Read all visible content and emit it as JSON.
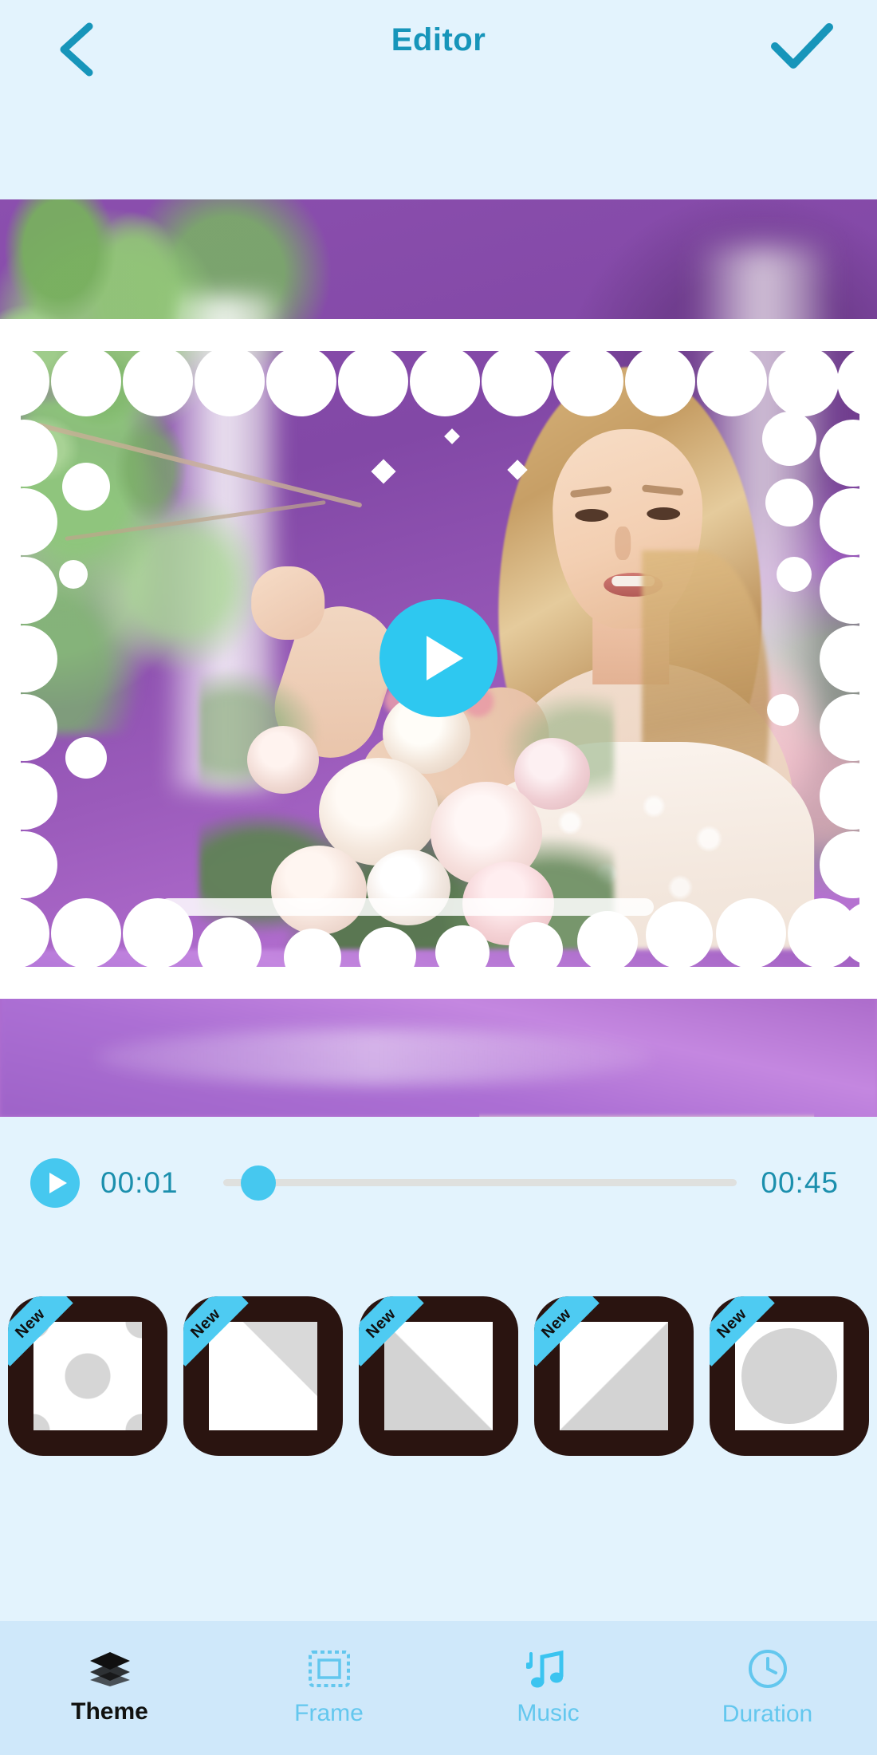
{
  "header": {
    "title": "Editor",
    "back_icon": "chevron-left-icon",
    "confirm_icon": "check-icon"
  },
  "preview": {
    "play_icon": "play-icon",
    "frame_style": "circle-cutout-overlay",
    "media_description": "bride holding bouquet of pale roses"
  },
  "timeline": {
    "play_icon": "play-icon",
    "current_time": "00:01",
    "total_time": "00:45",
    "progress_percent": 5,
    "knob_color": "#46c8ef",
    "track_color": "#dfe0de",
    "time_color": "#1b8fad"
  },
  "themes": {
    "badge_label": "New",
    "badge_color": "#4ecbf2",
    "tile_color": "#2a1410",
    "items": [
      {
        "name": "theme-circles",
        "shape": "sh-circles",
        "badge": "New"
      },
      {
        "name": "theme-corner-fold",
        "shape": "sh-corner",
        "badge": "New"
      },
      {
        "name": "theme-diagonal-left",
        "shape": "sh-diag",
        "badge": "New"
      },
      {
        "name": "theme-diagonal-right",
        "shape": "sh-diag2",
        "badge": "New"
      },
      {
        "name": "theme-circle",
        "shape": "sh-circle",
        "badge": "New"
      }
    ]
  },
  "bottom_nav": {
    "active_index": 0,
    "active_color": "#10110f",
    "inactive_color": "#63c7ee",
    "bar_color": "#cfe8fa",
    "items": [
      {
        "label": "Theme",
        "icon": "layers-icon"
      },
      {
        "label": "Frame",
        "icon": "frame-icon"
      },
      {
        "label": "Music",
        "icon": "music-note-icon"
      },
      {
        "label": "Duration",
        "icon": "clock-icon"
      }
    ]
  },
  "colors": {
    "app_bg": "#e3f3fd",
    "accent": "#2ec8f0",
    "title": "#1795ba"
  }
}
